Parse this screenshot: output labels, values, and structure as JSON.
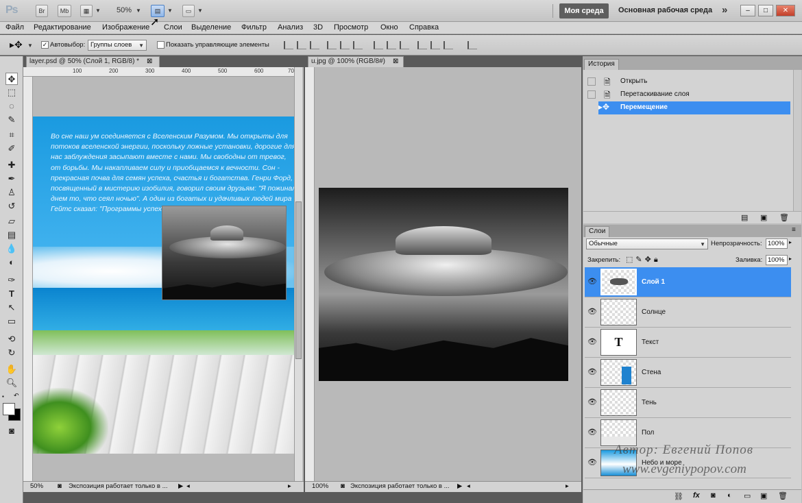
{
  "app": {
    "logo": "Ps",
    "zoom": "50%",
    "bridge_btn": "Br",
    "minibridge_btn": "Mb"
  },
  "workspace": {
    "active": "Моя среда",
    "main": "Основная рабочая среда",
    "more": "»"
  },
  "window_controls": {
    "minimize": "–",
    "maximize": "□",
    "close": "✕"
  },
  "menu": [
    "Файл",
    "Редактирование",
    "Изображение",
    "Слои",
    "Выделение",
    "Фильтр",
    "Анализ",
    "3D",
    "Просмотр",
    "Окно",
    "Справка"
  ],
  "options_bar": {
    "auto_select_label": "Автовыбор:",
    "auto_select_value": "Группы слоев",
    "show_controls_label": "Показать управляющие элементы"
  },
  "doc1": {
    "tab": "layer.psd @ 50% (Слой 1, RGB/8) *",
    "ruler_ticks": [
      "100",
      "200",
      "300",
      "400",
      "500",
      "600",
      "700"
    ],
    "body_text": "Во сне наш ум соединяется с Вселенским Разумом. Мы открыты для потоков вселенской энергии, поскольку ложные установки, дорогие для нас заблуждения засыпают вместе с нами. Мы свободны от тревог, от борьбы. Мы накапливаем силу и приобщаемся к вечности. Сон - прекрасная почва для семян успеха, счастья и богатства. Генри Форд, посвященный в мистерию изобилия, говорил своим друзьям: \"Я пожинал днем то, что сеял ночью\". А один из богатых и удачливых людей мира Гейтс сказал: \"Программы успеха написаны рукой сновидений\".",
    "status_zoom": "50%",
    "status_text": "Экспозиция работает только в ..."
  },
  "doc2": {
    "tab": "u.jpg @ 100% (RGB/8#)",
    "status_zoom": "100%",
    "status_text": "Экспозиция работает только в ..."
  },
  "history": {
    "tab": "История",
    "items": [
      {
        "label": "Открыть",
        "selected": false
      },
      {
        "label": "Перетаскивание слоя",
        "selected": false
      },
      {
        "label": "Перемещение",
        "selected": true
      }
    ]
  },
  "layers": {
    "tab": "Слои",
    "blend_mode": "Обычные",
    "opacity_label": "Непрозрачность:",
    "opacity_value": "100%",
    "lock_label": "Закрепить:",
    "fill_label": "Заливка:",
    "fill_value": "100%",
    "items": [
      {
        "name": "Слой 1",
        "selected": true
      },
      {
        "name": "Солнце",
        "selected": false
      },
      {
        "name": "Текст",
        "selected": false
      },
      {
        "name": "Стена",
        "selected": false
      },
      {
        "name": "Тень",
        "selected": false
      },
      {
        "name": "Пол",
        "selected": false
      },
      {
        "name": "Небо и море",
        "selected": false
      }
    ]
  },
  "watermark": {
    "author": "Автор: Евгений Попов",
    "site": "www.evgeniypopov.com"
  },
  "colors": {
    "selection": "#3c8ef0",
    "sky": "#1e9fe0",
    "panel": "#d3d3d3"
  }
}
